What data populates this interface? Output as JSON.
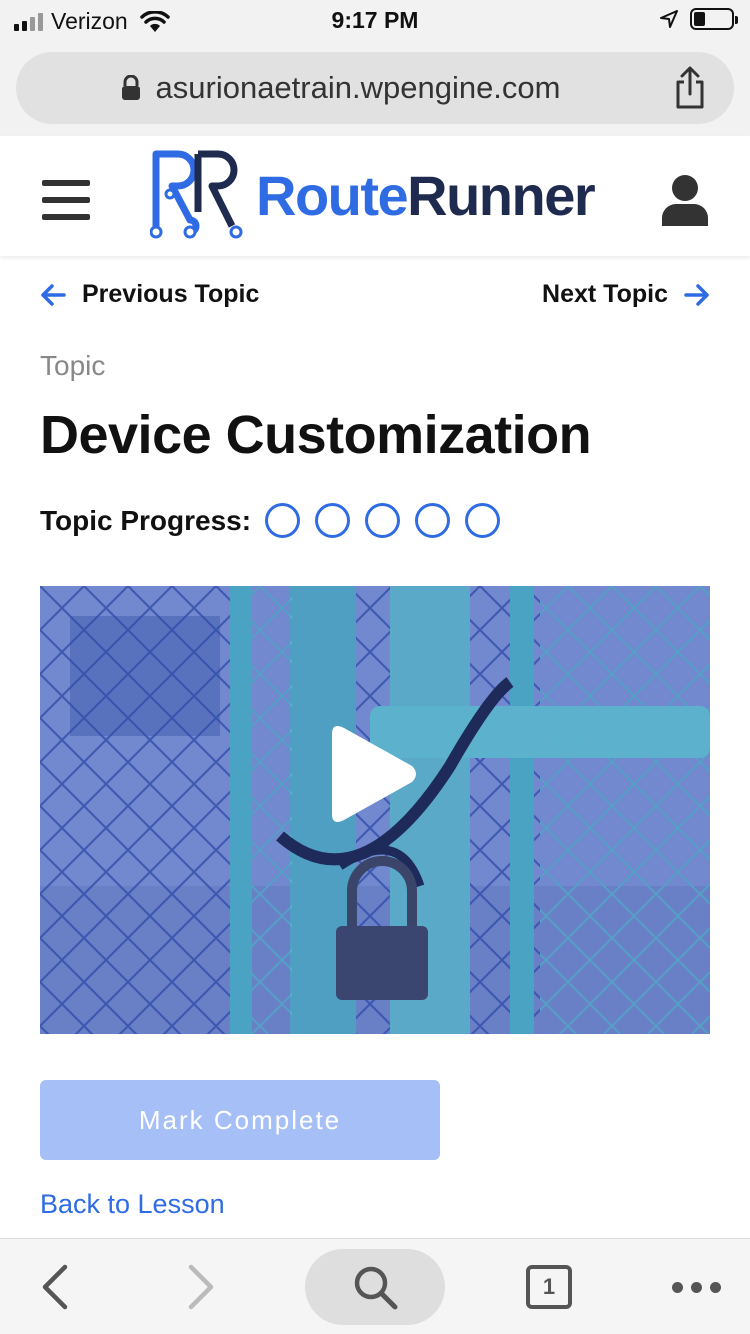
{
  "status_bar": {
    "carrier": "Verizon",
    "time": "9:17 PM",
    "battery_level": 0.3
  },
  "browser": {
    "url": "asurionaetrain.wpengine.com",
    "tab_count": "1"
  },
  "header": {
    "logo_route": "Route",
    "logo_runner": "Runner",
    "brand_color": "#2f6be3",
    "brand_dark_color": "#1f2a4f"
  },
  "topic_nav": {
    "previous_label": "Previous Topic",
    "next_label": "Next Topic"
  },
  "topic": {
    "kicker": "Topic",
    "title": "Device Customization",
    "progress_label": "Topic Progress:",
    "progress_steps": [
      false,
      false,
      false,
      false,
      false
    ]
  },
  "video": {
    "play_icon": "play-icon",
    "thumbnail": "padlocked chain-link gate"
  },
  "actions": {
    "mark_complete_label": "Mark Complete",
    "back_to_lesson_label": "Back to Lesson"
  },
  "icons": {
    "lock": "lock-icon",
    "share": "share-icon",
    "menu": "hamburger-icon",
    "user": "user-icon",
    "arrow_left": "arrow-left-icon",
    "arrow_right": "arrow-right-icon",
    "search": "search-icon",
    "more": "more-icon"
  }
}
